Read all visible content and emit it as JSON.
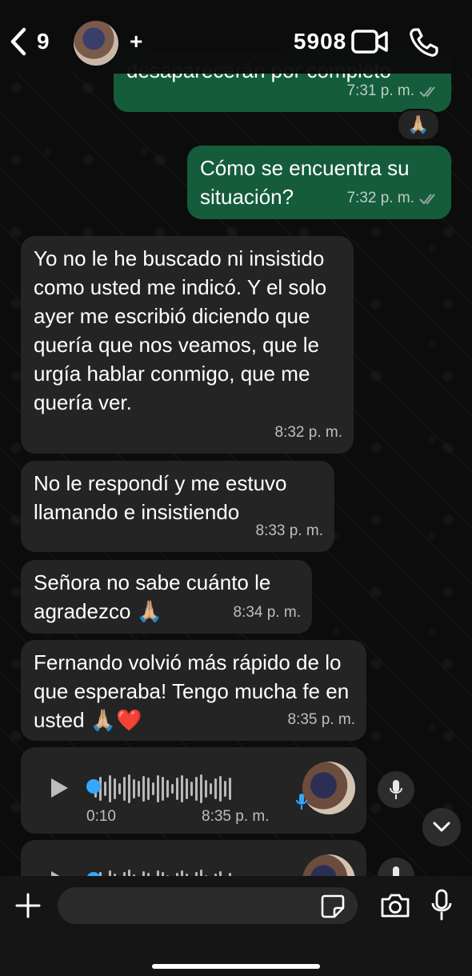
{
  "header": {
    "back_count": "9",
    "contact_name_prefix": "+",
    "contact_name_suffix": "5908"
  },
  "messages": [
    {
      "type": "out",
      "text": "desaparecerán por completo",
      "time": "7:31 p. m."
    },
    {
      "type": "reaction",
      "emoji": "🙏🏼"
    },
    {
      "type": "out",
      "text": "Cómo se encuentra su situación?",
      "time": "7:32 p. m."
    },
    {
      "type": "in",
      "text": "Yo no le he buscado ni insistido como usted me indicó. Y el solo ayer me escribió diciendo que quería que nos veamos, que le urgía hablar conmigo, que me quería ver.",
      "time": "8:32 p. m."
    },
    {
      "type": "in",
      "text": "No le respondí y me estuvo llamando e insistiendo",
      "time": "8:33 p. m."
    },
    {
      "type": "in",
      "text": "Señora no sabe cuánto le agradezco 🙏🏼",
      "time": "8:34 p. m."
    },
    {
      "type": "in",
      "text": "Fernando volvió más rápido de lo que esperaba! Tengo mucha fe en usted 🙏🏼❤️",
      "time": "8:35 p. m."
    },
    {
      "type": "voice",
      "duration": "0:10",
      "time": "8:35 p. m."
    }
  ],
  "composer": {
    "placeholder": ""
  },
  "icons": {
    "video_call": "video-camera-icon",
    "voice_call": "phone-icon",
    "play": "play-icon",
    "mic": "microphone-icon",
    "sticker": "sticker-icon",
    "camera": "camera-icon",
    "add": "plus-icon",
    "scroll_down": "chevron-down-icon"
  },
  "colors": {
    "outgoing_bubble": "#155c3b",
    "incoming_bubble": "#242424",
    "read_ticks": "#9aa7a1",
    "voice_progress": "#34a7ff"
  }
}
